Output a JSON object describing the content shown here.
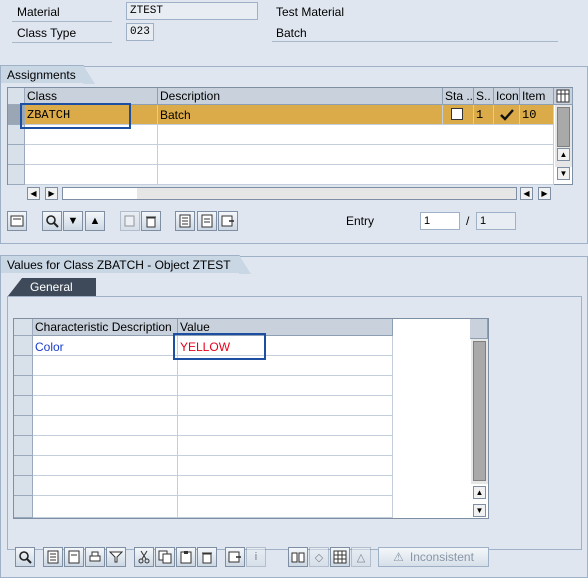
{
  "header": {
    "material_label": "Material",
    "material_value": "ZTEST",
    "material_desc": "Test Material",
    "class_type_label": "Class Type",
    "class_type_value": "023",
    "class_type_desc": "Batch"
  },
  "assignments": {
    "title": "Assignments",
    "columns": [
      "Class",
      "Description",
      "Sta ..",
      "S..",
      "Icon",
      "Item"
    ],
    "rows": [
      {
        "class": "ZBATCH",
        "description": "Batch",
        "status": "1",
        "icon": "checkmark-icon",
        "item": "10"
      }
    ],
    "entry_label": "Entry",
    "entry_value": "1",
    "entry_sep": "/",
    "entry_total": "1"
  },
  "values": {
    "title": "Values for Class ZBATCH - Object ZTEST",
    "tab_label": "General",
    "columns": [
      "Characteristic Description",
      "Value"
    ],
    "rows": [
      {
        "characteristic": "Color",
        "value": "YELLOW"
      }
    ],
    "inconsistent_label": "Inconsistent"
  },
  "colors": {
    "selected_row": "#dbab49",
    "background": "#dfe6ef",
    "value_red": "#e8001a",
    "char_blue": "#1a3cc8"
  }
}
